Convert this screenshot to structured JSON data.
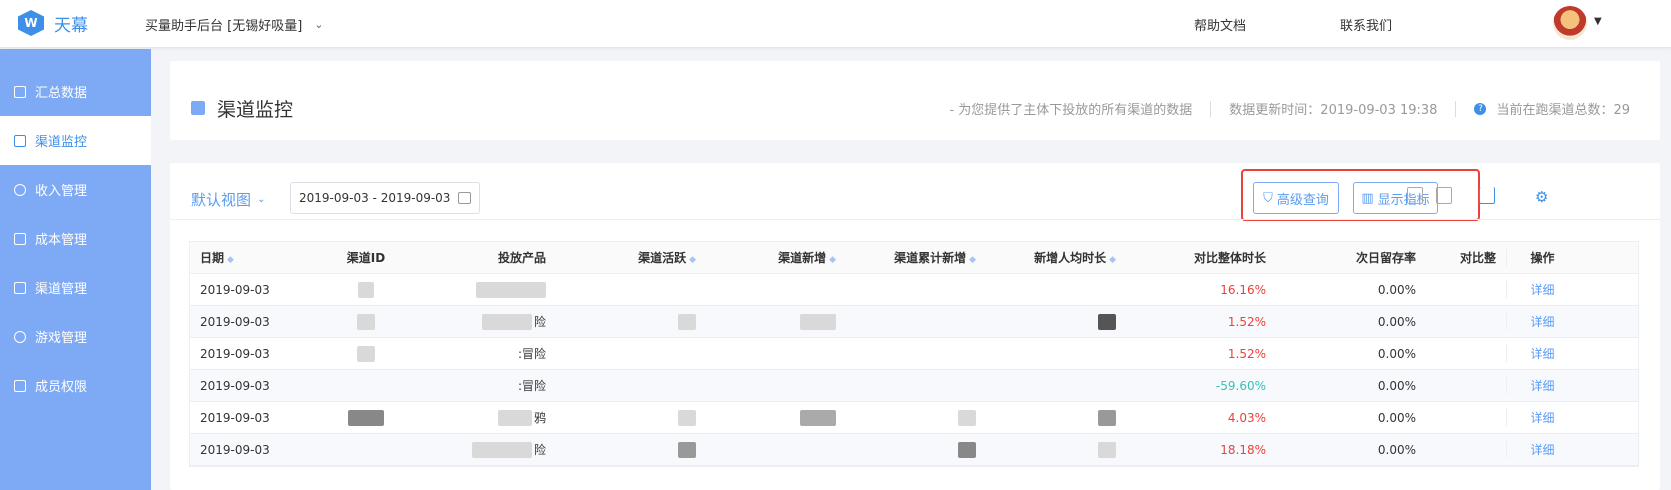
{
  "header": {
    "logo_text": "天幕",
    "logo_mark": "W",
    "app_selector": "买量助手后台 [无锡好吸量]",
    "help_docs": "帮助文档",
    "contact_us": "联系我们"
  },
  "sidebar": {
    "items": [
      {
        "label": "汇总数据",
        "icon": "bar-chart-icon"
      },
      {
        "label": "渠道监控",
        "icon": "monitor-icon",
        "active": true
      },
      {
        "label": "收入管理",
        "icon": "yen-icon"
      },
      {
        "label": "成本管理",
        "icon": "document-icon"
      },
      {
        "label": "渠道管理",
        "icon": "clipboard-icon"
      },
      {
        "label": "游戏管理",
        "icon": "gamepad-icon"
      },
      {
        "label": "成员权限",
        "icon": "user-card-icon"
      }
    ]
  },
  "page_header": {
    "title": "渠道监控",
    "description": "- 为您提供了主体下投放的所有渠道的数据",
    "update_time": "数据更新时间：2019-09-03 19:38",
    "running_channels": "当前在跑渠道总数：29"
  },
  "toolbar": {
    "view_select": "默认视图",
    "date_range": "2019-09-03 - 2019-09-03",
    "advanced_query": "高级查询",
    "show_metrics": "显示指标"
  },
  "table": {
    "headers": {
      "date": "日期",
      "channel_id": "渠道ID",
      "product": "投放产品",
      "active": "渠道活跃",
      "new": "渠道新增",
      "cumulative": "渠道累计新增",
      "avg_duration": "新增人均时长",
      "compare_duration": "对比整体时长",
      "next_day_retention": "次日留存率",
      "compare_partial": "对比整",
      "actions": "操作"
    },
    "rows": [
      {
        "date": "2019-09-03",
        "product": "",
        "compare": "16.16%",
        "retention": "0.00%",
        "action": "详细"
      },
      {
        "date": "2019-09-03",
        "product": "险",
        "compare": "1.52%",
        "retention": "0.00%",
        "action": "详细"
      },
      {
        "date": "2019-09-03",
        "product": ":冒险",
        "compare": "1.52%",
        "retention": "0.00%",
        "action": "详细"
      },
      {
        "date": "2019-09-03",
        "product": ":冒险",
        "compare": "-59.60%",
        "retention": "0.00%",
        "action": "详细"
      },
      {
        "date": "2019-09-03",
        "product": "鸦",
        "compare": "4.03%",
        "retention": "0.00%",
        "action": "详细"
      },
      {
        "date": "2019-09-03",
        "product": "险",
        "compare": "18.18%",
        "retention": "0.00%",
        "action": "详细"
      }
    ]
  },
  "colors": {
    "accent": "#3d8fe8",
    "sidebar_bg": "#7eaaf5",
    "negative": "#e8433a",
    "positive": "#38c1b8",
    "highlight_box": "#e8433a"
  }
}
